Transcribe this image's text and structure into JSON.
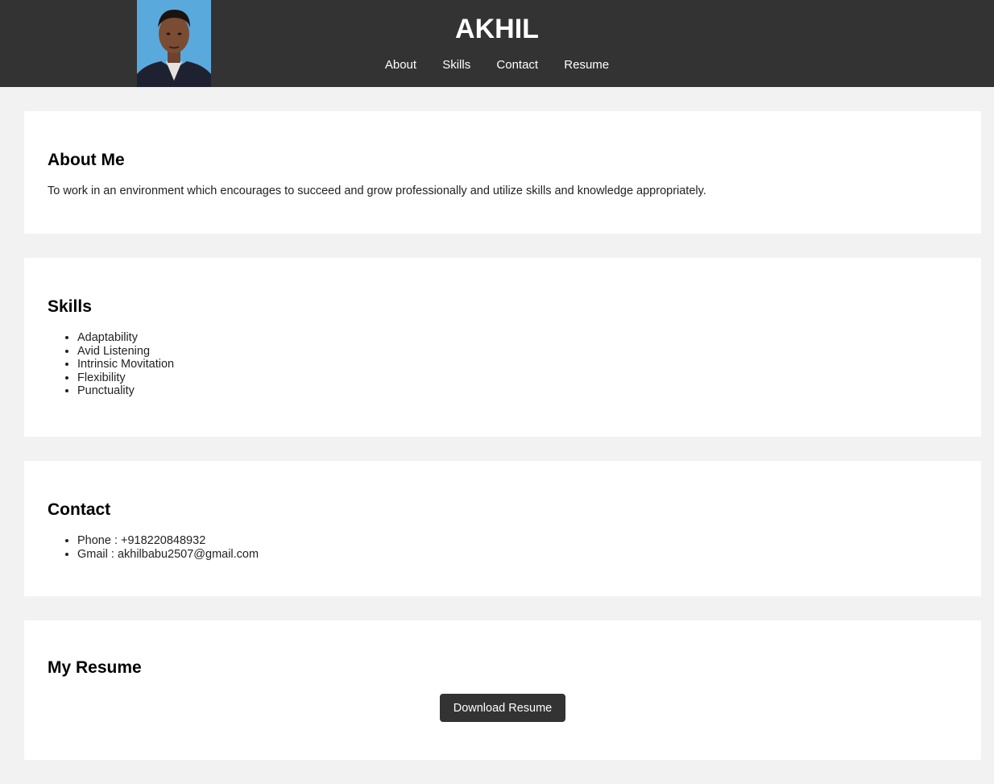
{
  "header": {
    "title": "AKHIL",
    "nav": [
      "About",
      "Skills",
      "Contact",
      "Resume"
    ]
  },
  "about": {
    "heading": "About Me",
    "text": "To work in an environment which encourages to succeed and grow professionally and utilize skills and knowledge appropriately."
  },
  "skills": {
    "heading": "Skills",
    "items": [
      "Adaptability",
      "Avid Listening",
      "Intrinsic Movitation",
      "Flexibility",
      "Punctuality"
    ]
  },
  "contact": {
    "heading": "Contact",
    "items": [
      "Phone : +918220848932",
      "Gmail : akhilbabu2507@gmail.com"
    ]
  },
  "resume": {
    "heading": "My Resume",
    "button_label": "Download Resume"
  },
  "colors": {
    "header_bg": "#333333",
    "page_bg": "#f2f2f2",
    "card_bg": "#ffffff"
  }
}
